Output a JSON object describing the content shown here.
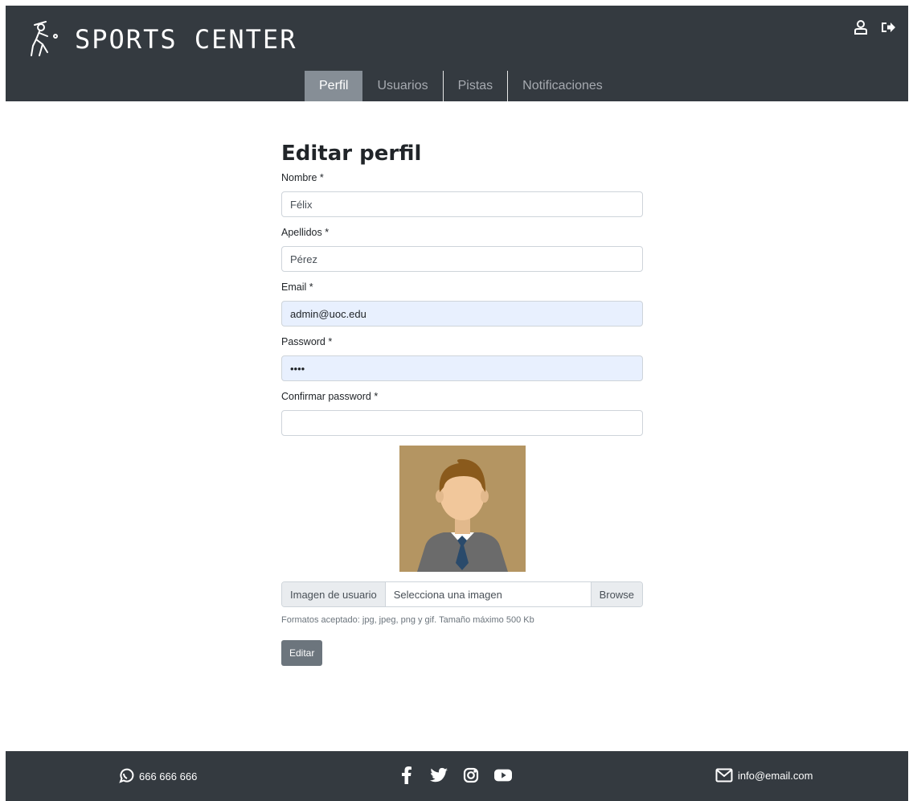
{
  "header": {
    "brand": "SPORTS CENTER",
    "icons": [
      "user-icon",
      "logout-icon"
    ]
  },
  "nav": {
    "items": [
      {
        "label": "Perfil",
        "active": true
      },
      {
        "label": "Usuarios",
        "active": false
      },
      {
        "label": "Pistas",
        "active": false
      },
      {
        "label": "Notificaciones",
        "active": false
      }
    ]
  },
  "form": {
    "title": "Editar perfil",
    "nombre": {
      "label": "Nombre *",
      "value": "Félix"
    },
    "apellidos": {
      "label": "Apellidos *",
      "value": "Pérez"
    },
    "email": {
      "label": "Email *",
      "value": "admin@uoc.edu"
    },
    "password": {
      "label": "Password *",
      "value": "••••"
    },
    "confirm": {
      "label": "Confirmar password *",
      "value": ""
    },
    "avatar_icon": "user-avatar-image",
    "file": {
      "prefix": "Imagen de usuario",
      "placeholder": "Selecciona una imagen",
      "browse": "Browse"
    },
    "help": "Formatos aceptado: jpg, jpeg, png y gif. Tamaño máximo 500 Kb",
    "submit": "Editar"
  },
  "footer": {
    "phone": "666 666 666",
    "email": "info@email.com",
    "social": [
      "facebook-icon",
      "twitter-icon",
      "instagram-icon",
      "youtube-icon"
    ]
  },
  "colors": {
    "header_bg": "#343a40",
    "nav_active_bg": "#868e96",
    "button_bg": "#6c757d",
    "autofill_bg": "#e8f0fe",
    "avatar_bg": "#b49562"
  }
}
